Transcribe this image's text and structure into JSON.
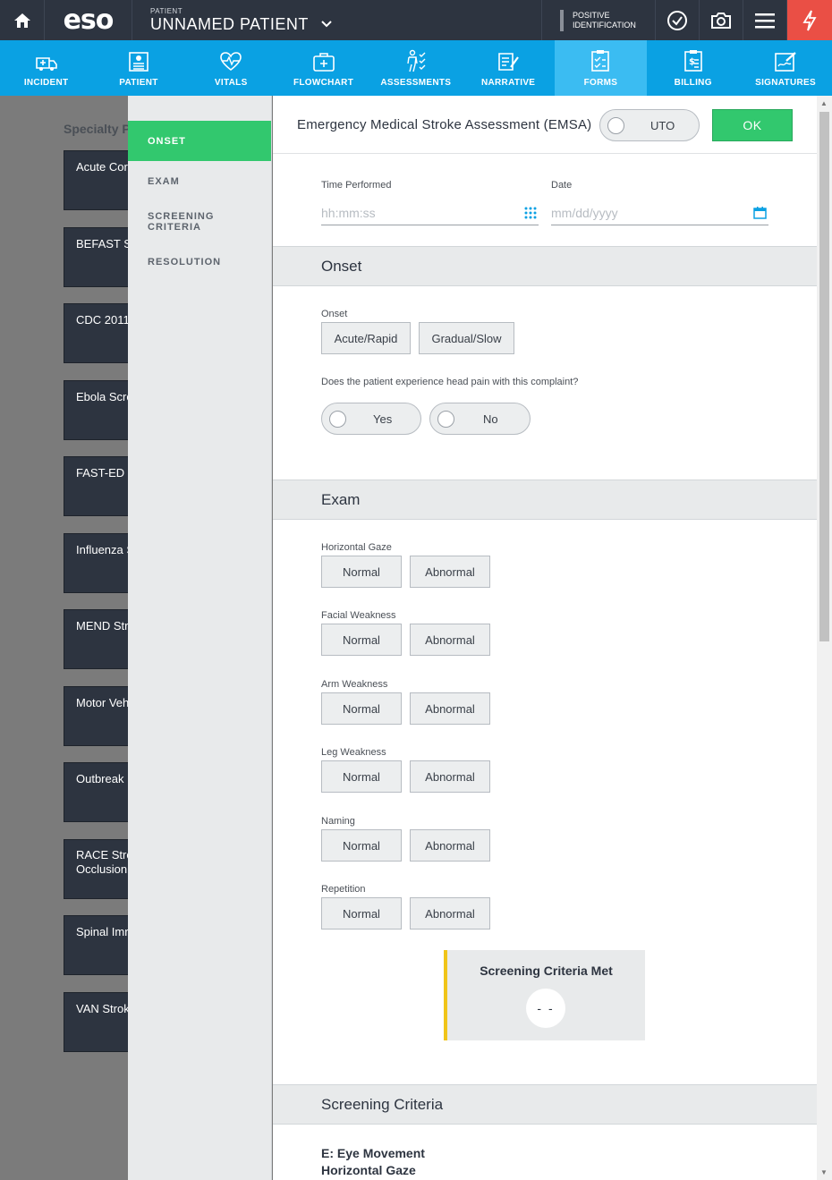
{
  "topbar": {
    "patient_small": "PATIENT",
    "patient_name": "UNNAMED PATIENT",
    "logo": "eso",
    "positive_id_line1": "POSITIVE",
    "positive_id_line2": "IDENTIFICATION",
    "icons": [
      "home-icon",
      "chevron-down-icon",
      "checkmark-circle-icon",
      "camera-icon",
      "hamburger-menu-icon",
      "lightning-bolt-icon"
    ]
  },
  "nav": {
    "items": [
      {
        "label": "INCIDENT",
        "icon": "ambulance-icon"
      },
      {
        "label": "PATIENT",
        "icon": "patient-id-icon"
      },
      {
        "label": "VITALS",
        "icon": "heartbeat-icon"
      },
      {
        "label": "FLOWCHART",
        "icon": "medkit-icon"
      },
      {
        "label": "ASSESSMENTS",
        "icon": "body-checklist-icon"
      },
      {
        "label": "NARRATIVE",
        "icon": "narrative-pen-icon"
      },
      {
        "label": "FORMS",
        "icon": "forms-checklist-icon"
      },
      {
        "label": "BILLING",
        "icon": "billing-icon"
      },
      {
        "label": "SIGNATURES",
        "icon": "signature-icon"
      }
    ],
    "active": "FORMS"
  },
  "specialty": {
    "title": "Specialty P",
    "cards": [
      "Acute Cor",
      "BEFAST St",
      "CDC 2011",
      "Ebola Scre",
      "FAST-ED S",
      "Influenza S",
      "MEND Stro",
      "Motor Veh",
      "Outbreak",
      "RACE Strok",
      "Spinal Imr",
      "VAN Strok"
    ],
    "race_line2": "Occlusion"
  },
  "sections": {
    "items": [
      "ONSET",
      "EXAM",
      "SCREENING CRITERIA",
      "RESOLUTION"
    ],
    "active": "ONSET"
  },
  "form": {
    "title": "Emergency Medical Stroke Assessment (EMSA)",
    "uto_label": "UTO",
    "ok_label": "OK",
    "time_label": "Time Performed",
    "time_placeholder": "hh:mm:ss",
    "date_label": "Date",
    "date_placeholder": "mm/dd/yyyy",
    "onset_band": "Onset",
    "onset_label": "Onset",
    "onset_options": [
      "Acute/Rapid",
      "Gradual/Slow"
    ],
    "head_pain_question": "Does the patient experience head pain with this complaint?",
    "head_pain_options": [
      "Yes",
      "No"
    ],
    "exam_band": "Exam",
    "exam_items": [
      {
        "label": "Horizontal Gaze",
        "options": [
          "Normal",
          "Abnormal"
        ]
      },
      {
        "label": "Facial Weakness",
        "options": [
          "Normal",
          "Abnormal"
        ]
      },
      {
        "label": "Arm Weakness",
        "options": [
          "Normal",
          "Abnormal"
        ]
      },
      {
        "label": "Leg Weakness",
        "options": [
          "Normal",
          "Abnormal"
        ]
      },
      {
        "label": "Naming",
        "options": [
          "Normal",
          "Abnormal"
        ]
      },
      {
        "label": "Repetition",
        "options": [
          "Normal",
          "Abnormal"
        ]
      }
    ],
    "criteria_met_title": "Screening Criteria Met",
    "criteria_met_value": "- -",
    "screening_band": "Screening Criteria",
    "screening_sub_line1": "E: Eye Movement",
    "screening_sub_line2": "Horizontal Gaze"
  },
  "colors": {
    "topbar": "#2d3440",
    "nav": "#0aa1e3",
    "nav_active": "#3bbcf2",
    "accent_green": "#32c86e",
    "alert_red": "#ea4f45",
    "criteria_yellow": "#f0c419"
  }
}
